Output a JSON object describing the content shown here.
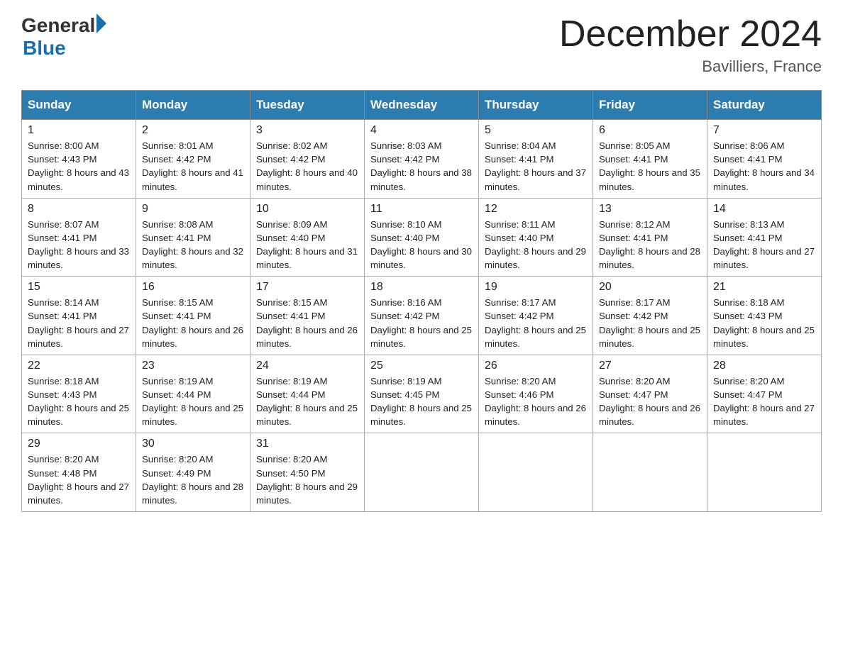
{
  "header": {
    "logo_general": "General",
    "logo_triangle": "▶",
    "logo_blue": "Blue",
    "title": "December 2024",
    "subtitle": "Bavilliers, France"
  },
  "weekdays": [
    "Sunday",
    "Monday",
    "Tuesday",
    "Wednesday",
    "Thursday",
    "Friday",
    "Saturday"
  ],
  "weeks": [
    [
      {
        "day": "1",
        "sunrise": "8:00 AM",
        "sunset": "4:43 PM",
        "daylight": "8 hours and 43 minutes."
      },
      {
        "day": "2",
        "sunrise": "8:01 AM",
        "sunset": "4:42 PM",
        "daylight": "8 hours and 41 minutes."
      },
      {
        "day": "3",
        "sunrise": "8:02 AM",
        "sunset": "4:42 PM",
        "daylight": "8 hours and 40 minutes."
      },
      {
        "day": "4",
        "sunrise": "8:03 AM",
        "sunset": "4:42 PM",
        "daylight": "8 hours and 38 minutes."
      },
      {
        "day": "5",
        "sunrise": "8:04 AM",
        "sunset": "4:41 PM",
        "daylight": "8 hours and 37 minutes."
      },
      {
        "day": "6",
        "sunrise": "8:05 AM",
        "sunset": "4:41 PM",
        "daylight": "8 hours and 35 minutes."
      },
      {
        "day": "7",
        "sunrise": "8:06 AM",
        "sunset": "4:41 PM",
        "daylight": "8 hours and 34 minutes."
      }
    ],
    [
      {
        "day": "8",
        "sunrise": "8:07 AM",
        "sunset": "4:41 PM",
        "daylight": "8 hours and 33 minutes."
      },
      {
        "day": "9",
        "sunrise": "8:08 AM",
        "sunset": "4:41 PM",
        "daylight": "8 hours and 32 minutes."
      },
      {
        "day": "10",
        "sunrise": "8:09 AM",
        "sunset": "4:40 PM",
        "daylight": "8 hours and 31 minutes."
      },
      {
        "day": "11",
        "sunrise": "8:10 AM",
        "sunset": "4:40 PM",
        "daylight": "8 hours and 30 minutes."
      },
      {
        "day": "12",
        "sunrise": "8:11 AM",
        "sunset": "4:40 PM",
        "daylight": "8 hours and 29 minutes."
      },
      {
        "day": "13",
        "sunrise": "8:12 AM",
        "sunset": "4:41 PM",
        "daylight": "8 hours and 28 minutes."
      },
      {
        "day": "14",
        "sunrise": "8:13 AM",
        "sunset": "4:41 PM",
        "daylight": "8 hours and 27 minutes."
      }
    ],
    [
      {
        "day": "15",
        "sunrise": "8:14 AM",
        "sunset": "4:41 PM",
        "daylight": "8 hours and 27 minutes."
      },
      {
        "day": "16",
        "sunrise": "8:15 AM",
        "sunset": "4:41 PM",
        "daylight": "8 hours and 26 minutes."
      },
      {
        "day": "17",
        "sunrise": "8:15 AM",
        "sunset": "4:41 PM",
        "daylight": "8 hours and 26 minutes."
      },
      {
        "day": "18",
        "sunrise": "8:16 AM",
        "sunset": "4:42 PM",
        "daylight": "8 hours and 25 minutes."
      },
      {
        "day": "19",
        "sunrise": "8:17 AM",
        "sunset": "4:42 PM",
        "daylight": "8 hours and 25 minutes."
      },
      {
        "day": "20",
        "sunrise": "8:17 AM",
        "sunset": "4:42 PM",
        "daylight": "8 hours and 25 minutes."
      },
      {
        "day": "21",
        "sunrise": "8:18 AM",
        "sunset": "4:43 PM",
        "daylight": "8 hours and 25 minutes."
      }
    ],
    [
      {
        "day": "22",
        "sunrise": "8:18 AM",
        "sunset": "4:43 PM",
        "daylight": "8 hours and 25 minutes."
      },
      {
        "day": "23",
        "sunrise": "8:19 AM",
        "sunset": "4:44 PM",
        "daylight": "8 hours and 25 minutes."
      },
      {
        "day": "24",
        "sunrise": "8:19 AM",
        "sunset": "4:44 PM",
        "daylight": "8 hours and 25 minutes."
      },
      {
        "day": "25",
        "sunrise": "8:19 AM",
        "sunset": "4:45 PM",
        "daylight": "8 hours and 25 minutes."
      },
      {
        "day": "26",
        "sunrise": "8:20 AM",
        "sunset": "4:46 PM",
        "daylight": "8 hours and 26 minutes."
      },
      {
        "day": "27",
        "sunrise": "8:20 AM",
        "sunset": "4:47 PM",
        "daylight": "8 hours and 26 minutes."
      },
      {
        "day": "28",
        "sunrise": "8:20 AM",
        "sunset": "4:47 PM",
        "daylight": "8 hours and 27 minutes."
      }
    ],
    [
      {
        "day": "29",
        "sunrise": "8:20 AM",
        "sunset": "4:48 PM",
        "daylight": "8 hours and 27 minutes."
      },
      {
        "day": "30",
        "sunrise": "8:20 AM",
        "sunset": "4:49 PM",
        "daylight": "8 hours and 28 minutes."
      },
      {
        "day": "31",
        "sunrise": "8:20 AM",
        "sunset": "4:50 PM",
        "daylight": "8 hours and 29 minutes."
      },
      null,
      null,
      null,
      null
    ]
  ]
}
